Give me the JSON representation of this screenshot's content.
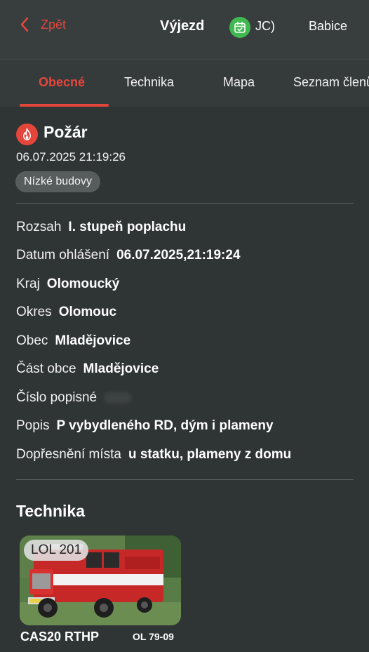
{
  "header": {
    "back_label": "Zpět",
    "title": "Výjezd",
    "user_initials": "JC)",
    "unit_name": "Babice",
    "accent_color": "#e5463c"
  },
  "tabs": [
    {
      "label": "Obecné",
      "active": true
    },
    {
      "label": "Technika",
      "active": false
    },
    {
      "label": "Mapa",
      "active": false
    },
    {
      "label": "Seznam členů",
      "active": false
    }
  ],
  "event": {
    "type": "Požár",
    "datetime": "06.07.2025 21:19:26",
    "tag": "Nízké budovy"
  },
  "details": [
    {
      "label": "Rozsah",
      "value": "I. stupeň poplachu"
    },
    {
      "label": "Datum ohlášení",
      "value": "06.07.2025,21:19:24"
    },
    {
      "label": "Kraj",
      "value": "Olomoucký"
    },
    {
      "label": "Okres",
      "value": "Olomouc"
    },
    {
      "label": "Obec",
      "value": "Mladějovice"
    },
    {
      "label": "Část obce",
      "value": "Mladějovice"
    },
    {
      "label": "Číslo popisné",
      "value": ""
    },
    {
      "label": "Popis",
      "value": "P vybydleného RD, dým i plameny"
    },
    {
      "label": "Dopřesnění místa",
      "value": "u statku, plameny z domu"
    }
  ],
  "technika": {
    "title": "Technika",
    "vehicles": [
      {
        "badge": "LOL 201",
        "name": "CAS20 RTHP",
        "plate": "OL 79-09"
      }
    ]
  }
}
